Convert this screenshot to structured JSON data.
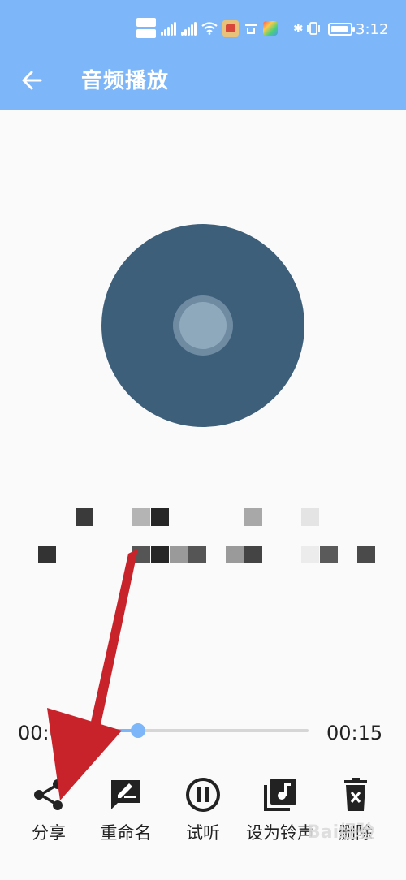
{
  "status_bar": {
    "time": "3:12",
    "battery_level": 0.9,
    "icons": [
      "hd-icon",
      "signal-4g-icon",
      "signal-4g-icon",
      "wifi-icon",
      "app-notification-icon",
      "app-notification-icon",
      "app-notification-icon",
      "bluetooth-icon",
      "vibrate-icon",
      "battery-icon"
    ]
  },
  "app_bar": {
    "title": "音频播放",
    "back_icon": "arrow-left-icon",
    "color": "#7db7f9"
  },
  "player": {
    "current_time": "00:0",
    "total_time": "00:15",
    "progress": 0.3,
    "accent_color": "#7db7f9",
    "record_color": "#3e5f7a"
  },
  "actions": [
    {
      "label": "分享",
      "icon": "share-icon"
    },
    {
      "label": "重命名",
      "icon": "rename-icon"
    },
    {
      "label": "试听",
      "icon": "pause-icon"
    },
    {
      "label": "设为铃声",
      "icon": "music-library-icon"
    },
    {
      "label": "删除",
      "icon": "delete-icon"
    }
  ],
  "annotation": {
    "arrow_color": "#c8232b"
  },
  "watermark": "Bai经验"
}
